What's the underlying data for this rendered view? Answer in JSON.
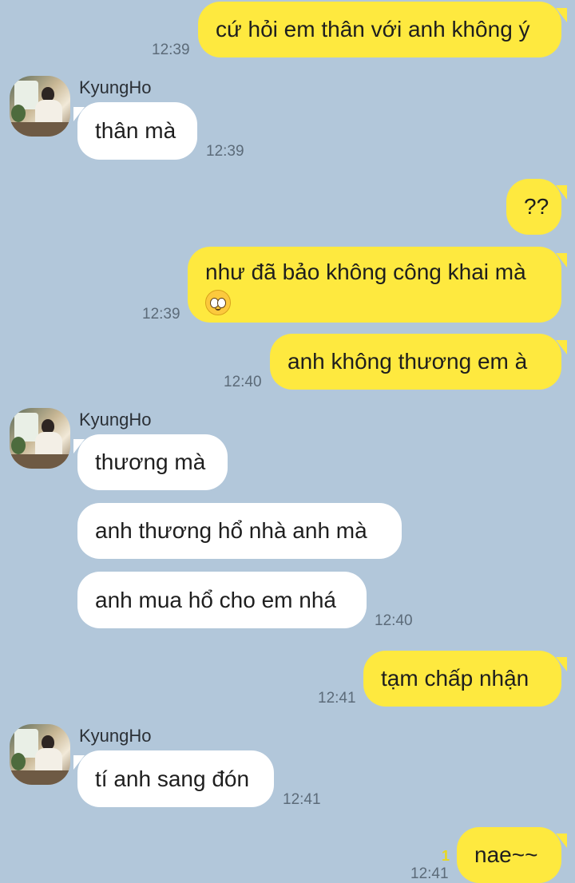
{
  "contact_name": "KyungHo",
  "messages": [
    {
      "id": "m1",
      "sender": "me",
      "text": "cứ hỏi em thân với anh không ý",
      "time": "12:39"
    },
    {
      "id": "m2",
      "sender": "them",
      "text": "thân mà",
      "time": "12:39"
    },
    {
      "id": "m3",
      "sender": "me",
      "text": "??"
    },
    {
      "id": "m4",
      "sender": "me",
      "text": "như đã bảo không công khai mà",
      "emoji": "pleading-face-icon",
      "time": "12:39"
    },
    {
      "id": "m5",
      "sender": "me",
      "text": "anh không thương em à",
      "time": "12:40"
    },
    {
      "id": "m6",
      "sender": "them",
      "text": "thương mà"
    },
    {
      "id": "m7",
      "sender": "them",
      "text": "anh thương hổ nhà anh mà"
    },
    {
      "id": "m8",
      "sender": "them",
      "text": "anh mua hổ cho em nhá",
      "time": "12:40"
    },
    {
      "id": "m9",
      "sender": "me",
      "text": "tạm chấp nhận",
      "time": "12:41"
    },
    {
      "id": "m10",
      "sender": "them",
      "text": "tí anh sang đón",
      "time": "12:41"
    },
    {
      "id": "m11",
      "sender": "me",
      "text": "nae~~",
      "time": "12:41",
      "unread_count": "1"
    }
  ],
  "colors": {
    "background": "#b2c7da",
    "my_bubble": "#fee93f",
    "their_bubble": "#ffffff",
    "unread": "#e8d81c"
  }
}
